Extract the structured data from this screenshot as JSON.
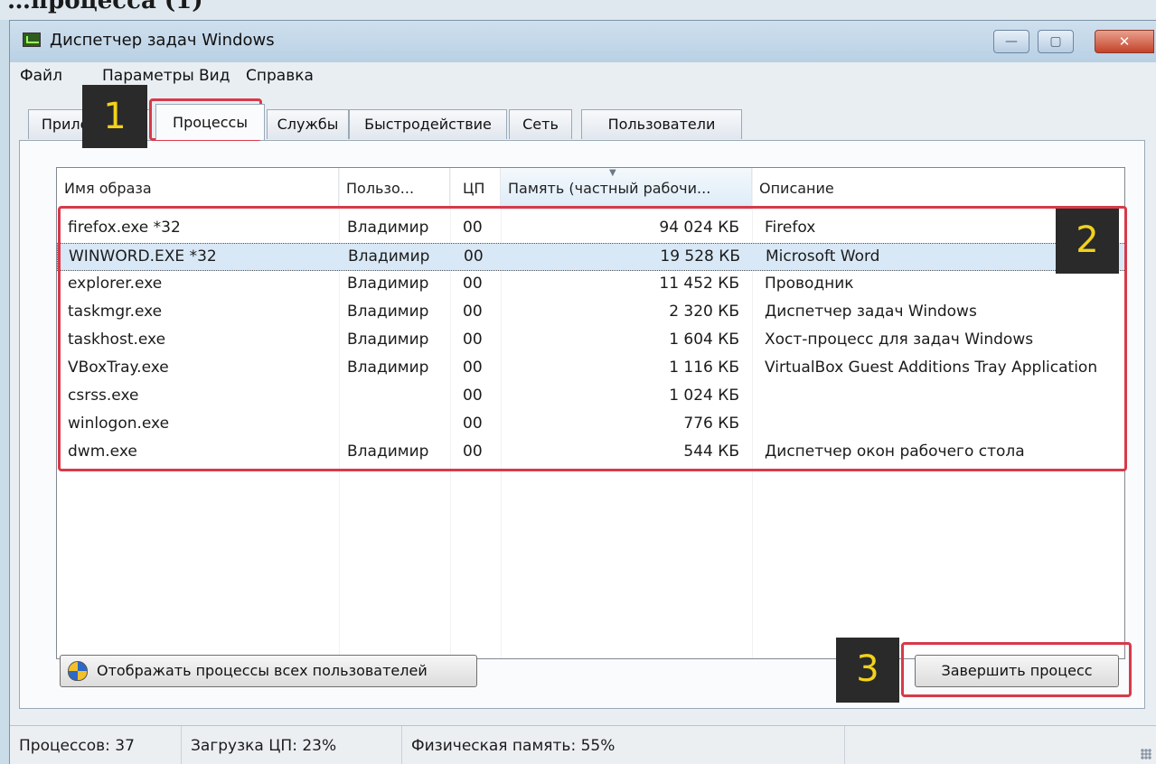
{
  "top_strip_text": "…процесса (1)",
  "window": {
    "title": "Диспетчер задач Windows",
    "min_label": "—",
    "max_label": "▢",
    "close_label": "✕"
  },
  "menu": [
    "Файл",
    "Параметры",
    "Вид",
    "Справка"
  ],
  "tabs": [
    "Приложения",
    "Процессы",
    "Службы",
    "Быстродействие",
    "Сеть",
    "Пользователи"
  ],
  "active_tab": "Процессы",
  "columns": [
    "Имя образа",
    "Пользо...",
    "ЦП",
    "Память (частный рабочи...",
    "Описание"
  ],
  "sort_indicator": "▼",
  "processes": [
    {
      "name": "firefox.exe *32",
      "user": "Владимир",
      "cpu": "00",
      "memory": "94 024 КБ",
      "description": "Firefox"
    },
    {
      "name": "WINWORD.EXE *32",
      "user": "Владимир",
      "cpu": "00",
      "memory": "19 528 КБ",
      "description": "Microsoft Word",
      "selected": true
    },
    {
      "name": "explorer.exe",
      "user": "Владимир",
      "cpu": "00",
      "memory": "11 452 КБ",
      "description": "Проводник"
    },
    {
      "name": "taskmgr.exe",
      "user": "Владимир",
      "cpu": "00",
      "memory": "2 320 КБ",
      "description": "Диспетчер задач Windows"
    },
    {
      "name": "taskhost.exe",
      "user": "Владимир",
      "cpu": "00",
      "memory": "1 604 КБ",
      "description": "Хост-процесс для задач Windows"
    },
    {
      "name": "VBoxTray.exe",
      "user": "Владимир",
      "cpu": "00",
      "memory": "1 116 КБ",
      "description": "VirtualBox Guest Additions Tray Application"
    },
    {
      "name": "csrss.exe",
      "user": "",
      "cpu": "00",
      "memory": "1 024 КБ",
      "description": ""
    },
    {
      "name": "winlogon.exe",
      "user": "",
      "cpu": "00",
      "memory": "776 КБ",
      "description": ""
    },
    {
      "name": "dwm.exe",
      "user": "Владимир",
      "cpu": "00",
      "memory": "544 КБ",
      "description": "Диспетчер окон рабочего стола"
    }
  ],
  "buttons": {
    "show_all": "Отображать процессы всех пользователей",
    "end_process": "Завершить процесс"
  },
  "status": {
    "processes": "Процессов: 37",
    "cpu": "Загрузка ЦП: 23%",
    "memory": "Физическая память: 55%"
  },
  "callouts": [
    "1",
    "2",
    "3"
  ],
  "colors": {
    "highlight": "#d63a4a",
    "callout_bg": "#2a2a2a",
    "callout_text": "#f2d21a",
    "selection": "#d8e8f6"
  }
}
